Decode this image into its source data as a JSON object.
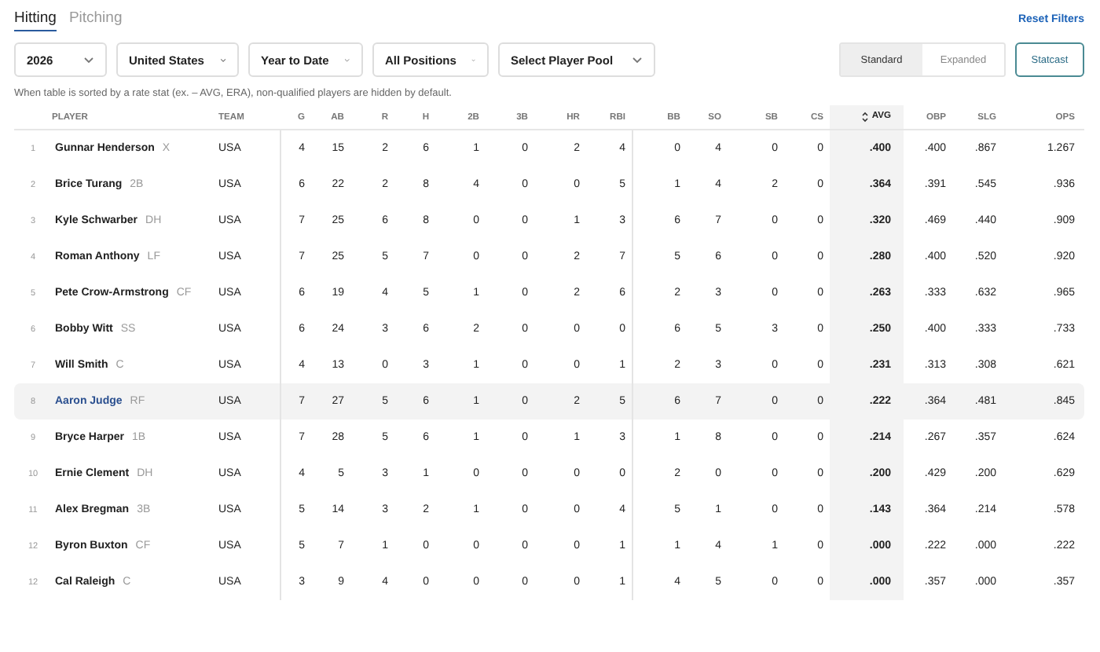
{
  "tabs": [
    {
      "label": "Hitting",
      "selected": true
    },
    {
      "label": "Pitching",
      "selected": false
    }
  ],
  "reset_link": "Reset Filters",
  "filters": [
    "2026",
    "United States",
    "Year to Date",
    "All Positions",
    "Select Player Pool"
  ],
  "view_toggle": [
    {
      "label": "Standard",
      "selected": true
    },
    {
      "label": "Expanded",
      "selected": false
    }
  ],
  "statcast_button": "Statcast",
  "note": "When table is sorted by a rate stat (ex. – AVG, ERA), non-qualified players are hidden by default.",
  "table": {
    "columns": [
      {
        "label": "PLAYER",
        "sorted": false
      },
      {
        "label": "TEAM",
        "sorted": false
      },
      {
        "label": "G",
        "sorted": false
      },
      {
        "label": "AB",
        "sorted": false
      },
      {
        "label": "R",
        "sorted": false
      },
      {
        "label": "H",
        "sorted": false
      },
      {
        "label": "2B",
        "sorted": false
      },
      {
        "label": "3B",
        "sorted": false
      },
      {
        "label": "HR",
        "sorted": false
      },
      {
        "label": "RBI",
        "sorted": false
      },
      {
        "label": "BB",
        "sorted": false
      },
      {
        "label": "SO",
        "sorted": false
      },
      {
        "label": "SB",
        "sorted": false
      },
      {
        "label": "CS",
        "sorted": false
      },
      {
        "label": "AVG",
        "sorted": true
      },
      {
        "label": "OBP",
        "sorted": false
      },
      {
        "label": "SLG",
        "sorted": false
      },
      {
        "label": "OPS",
        "sorted": false
      }
    ],
    "rows": [
      {
        "rank": "1",
        "name": "Gunnar Henderson",
        "position": "X",
        "team": "USA",
        "selected": false,
        "stats": [
          "4",
          "15",
          "2",
          "6",
          "1",
          "0",
          "2",
          "4",
          "0",
          "4",
          "0",
          "0",
          ".400",
          ".400",
          ".867",
          "1.267"
        ]
      },
      {
        "rank": "2",
        "name": "Brice Turang",
        "position": "2B",
        "team": "USA",
        "selected": false,
        "stats": [
          "6",
          "22",
          "2",
          "8",
          "4",
          "0",
          "0",
          "5",
          "1",
          "4",
          "2",
          "0",
          ".364",
          ".391",
          ".545",
          ".936"
        ]
      },
      {
        "rank": "3",
        "name": "Kyle Schwarber",
        "position": "DH",
        "team": "USA",
        "selected": false,
        "stats": [
          "7",
          "25",
          "6",
          "8",
          "0",
          "0",
          "1",
          "3",
          "6",
          "7",
          "0",
          "0",
          ".320",
          ".469",
          ".440",
          ".909"
        ]
      },
      {
        "rank": "4",
        "name": "Roman Anthony",
        "position": "LF",
        "team": "USA",
        "selected": false,
        "stats": [
          "7",
          "25",
          "5",
          "7",
          "0",
          "0",
          "2",
          "7",
          "5",
          "6",
          "0",
          "0",
          ".280",
          ".400",
          ".520",
          ".920"
        ]
      },
      {
        "rank": "5",
        "name": "Pete Crow-Armstrong",
        "position": "CF",
        "team": "USA",
        "selected": false,
        "stats": [
          "6",
          "19",
          "4",
          "5",
          "1",
          "0",
          "2",
          "6",
          "2",
          "3",
          "0",
          "0",
          ".263",
          ".333",
          ".632",
          ".965"
        ]
      },
      {
        "rank": "6",
        "name": "Bobby Witt",
        "position": "SS",
        "team": "USA",
        "selected": false,
        "stats": [
          "6",
          "24",
          "3",
          "6",
          "2",
          "0",
          "0",
          "0",
          "6",
          "5",
          "3",
          "0",
          ".250",
          ".400",
          ".333",
          ".733"
        ]
      },
      {
        "rank": "7",
        "name": "Will Smith",
        "position": "C",
        "team": "USA",
        "selected": false,
        "stats": [
          "4",
          "13",
          "0",
          "3",
          "1",
          "0",
          "0",
          "1",
          "2",
          "3",
          "0",
          "0",
          ".231",
          ".313",
          ".308",
          ".621"
        ]
      },
      {
        "rank": "8",
        "name": "Aaron Judge",
        "position": "RF",
        "team": "USA",
        "selected": true,
        "stats": [
          "7",
          "27",
          "5",
          "6",
          "1",
          "0",
          "2",
          "5",
          "6",
          "7",
          "0",
          "0",
          ".222",
          ".364",
          ".481",
          ".845"
        ]
      },
      {
        "rank": "9",
        "name": "Bryce Harper",
        "position": "1B",
        "team": "USA",
        "selected": false,
        "stats": [
          "7",
          "28",
          "5",
          "6",
          "1",
          "0",
          "1",
          "3",
          "1",
          "8",
          "0",
          "0",
          ".214",
          ".267",
          ".357",
          ".624"
        ]
      },
      {
        "rank": "10",
        "name": "Ernie Clement",
        "position": "DH",
        "team": "USA",
        "selected": false,
        "stats": [
          "4",
          "5",
          "3",
          "1",
          "0",
          "0",
          "0",
          "0",
          "2",
          "0",
          "0",
          "0",
          ".200",
          ".429",
          ".200",
          ".629"
        ]
      },
      {
        "rank": "11",
        "name": "Alex Bregman",
        "position": "3B",
        "team": "USA",
        "selected": false,
        "stats": [
          "5",
          "14",
          "3",
          "2",
          "1",
          "0",
          "0",
          "4",
          "5",
          "1",
          "0",
          "0",
          ".143",
          ".364",
          ".214",
          ".578"
        ]
      },
      {
        "rank": "12",
        "name": "Byron Buxton",
        "position": "CF",
        "team": "USA",
        "selected": false,
        "stats": [
          "5",
          "7",
          "1",
          "0",
          "0",
          "0",
          "0",
          "1",
          "1",
          "4",
          "1",
          "0",
          ".000",
          ".222",
          ".000",
          ".222"
        ]
      },
      {
        "rank": "12",
        "name": "Cal Raleigh",
        "position": "C",
        "team": "USA",
        "selected": false,
        "stats": [
          "3",
          "9",
          "4",
          "0",
          "0",
          "0",
          "0",
          "1",
          "4",
          "5",
          "0",
          "0",
          ".000",
          ".357",
          ".000",
          ".357"
        ]
      }
    ]
  }
}
